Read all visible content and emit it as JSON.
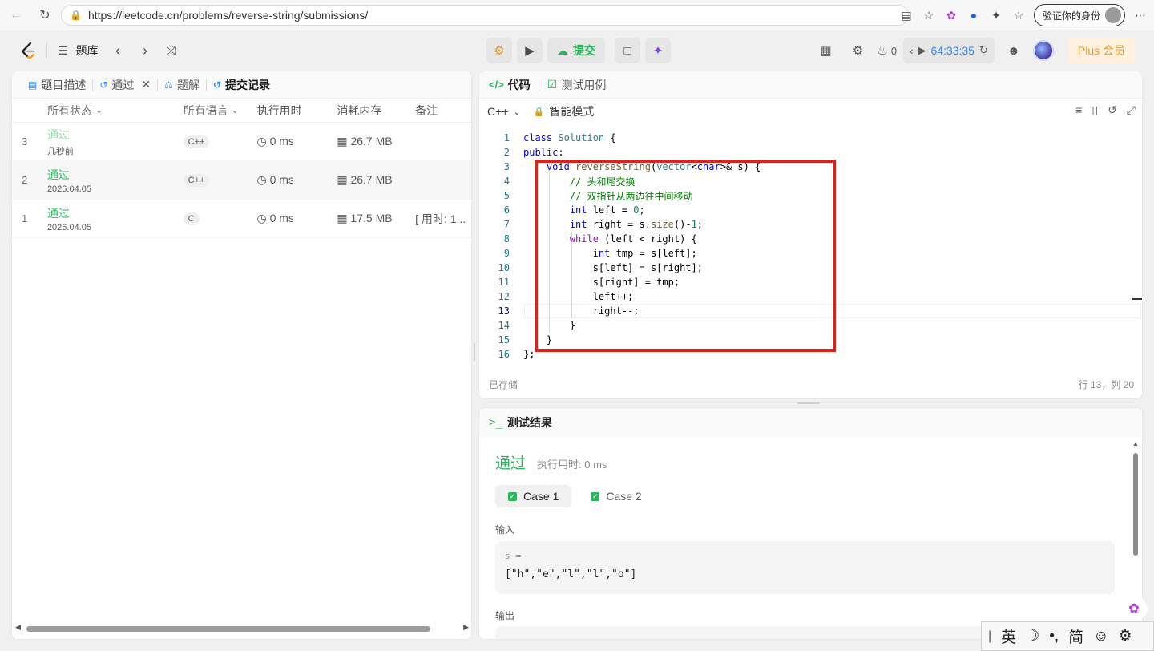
{
  "browser": {
    "url": "https://leetcode.cn/problems/reverse-string/submissions/",
    "identity_label": "验证你的身份"
  },
  "header": {
    "problem_bank": "题库",
    "submit_label": "提交",
    "streak_count": "0",
    "timer": "64:33:35",
    "plus_label": "Plus 会员"
  },
  "left_tabs": {
    "description": "题目描述",
    "passed": "通过",
    "solutions": "题解",
    "submissions": "提交记录"
  },
  "submissions_table": {
    "headers": {
      "status": "所有状态",
      "language": "所有语言",
      "runtime": "执行用时",
      "memory": "消耗内存",
      "note": "备注"
    },
    "rows": [
      {
        "index": "3",
        "status": "通过",
        "time": "几秒前",
        "language": "C++",
        "runtime": "0 ms",
        "memory": "26.7 MB",
        "note": ""
      },
      {
        "index": "2",
        "status": "通过",
        "time": "2026.04.05",
        "language": "C++",
        "runtime": "0 ms",
        "memory": "26.7 MB",
        "note": ""
      },
      {
        "index": "1",
        "status": "通过",
        "time": "2026.04.05",
        "language": "C",
        "runtime": "0 ms",
        "memory": "17.5 MB",
        "note": "[ 用时: 1..."
      }
    ]
  },
  "code_panel": {
    "tab_code": "代码",
    "tab_testcase": "测试用例",
    "language": "C++",
    "mode": "智能模式",
    "saved": "已存储",
    "cursor_pos": "行 13，列 20",
    "lines": [
      "class Solution {",
      "public:",
      "    void reverseString(vector<char>& s) {",
      "        // 头和尾交换",
      "        // 双指针从两边往中间移动",
      "        int left = 0;",
      "        int right = s.size()-1;",
      "        while (left < right) {",
      "            int tmp = s[left];",
      "            s[left] = s[right];",
      "            s[right] = tmp;",
      "            left++;",
      "            right--;",
      "        }",
      "    }",
      "};"
    ]
  },
  "result_panel": {
    "title": "测试结果",
    "status": "通过",
    "exec_time": "执行用时: 0 ms",
    "case1": "Case 1",
    "case2": "Case 2",
    "input_label": "输入",
    "input_var": "s =",
    "input_value": "[\"h\",\"e\",\"l\",\"l\",\"o\"]",
    "output_label": "输出"
  },
  "ime": {
    "lang": "英",
    "script": "简"
  }
}
